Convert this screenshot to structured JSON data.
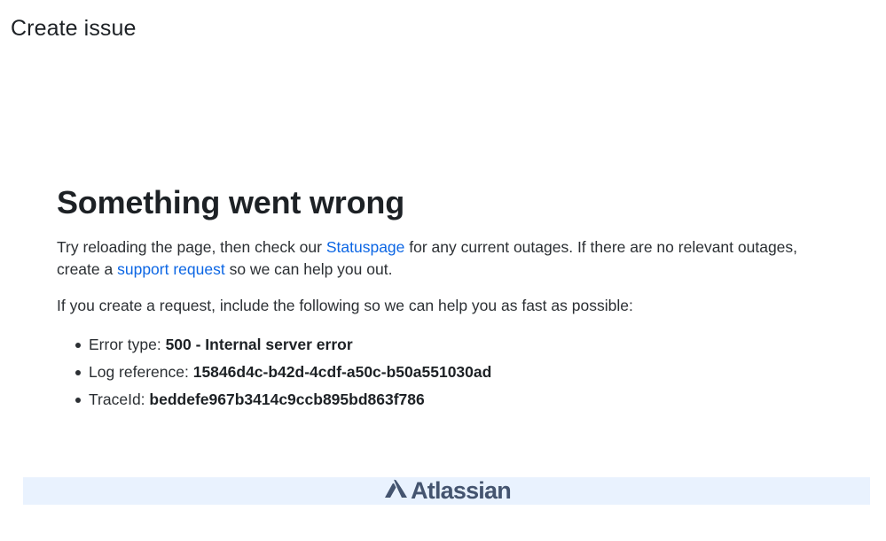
{
  "header": {
    "title": "Create issue"
  },
  "error": {
    "heading": "Something went wrong",
    "intro": {
      "part1": "Try reloading the page, then check our ",
      "statuspage_link": "Statuspage",
      "part2": " for any current outages. If there are no relevant outages, create a ",
      "support_link": "support request",
      "part3": " so we can help you out."
    },
    "request_instructions": "If you create a request, include the following so we can help you as fast as possible:",
    "details": [
      {
        "label": "Error type: ",
        "value": "500 - Internal server error"
      },
      {
        "label": "Log reference: ",
        "value": "15846d4c-b42d-4cdf-a50c-b50a551030ad"
      },
      {
        "label": "TraceId: ",
        "value": "beddefe967b3414c9ccb895bd863f786"
      }
    ]
  },
  "footer": {
    "brand_name": "Atlassian",
    "brand_icon": "atlassian-logo-icon",
    "background_color": "#e9f2fe"
  },
  "colors": {
    "link": "#0c66e4",
    "text": "#2b2f33",
    "heading": "#1d2125"
  }
}
